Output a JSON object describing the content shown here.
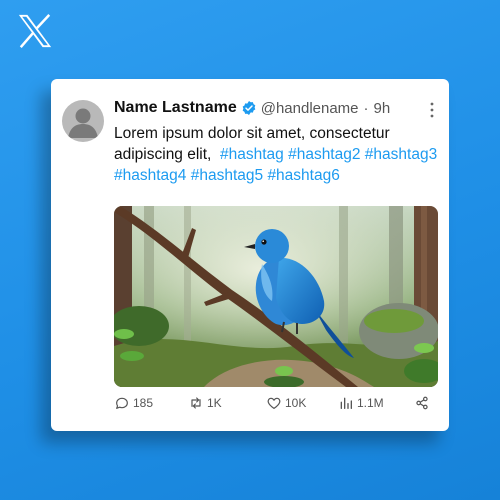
{
  "brand": {
    "logo_icon": "x-logo-icon"
  },
  "tweet": {
    "author_name": "Name Lastname",
    "handle": "@handlename",
    "separator": "·",
    "time": "9h",
    "verified_icon": "verified-badge-icon",
    "text": "Lorem ipsum dolor sit amet, consectetur adipiscing elit,",
    "hashtags": [
      "#hashtag",
      "#hashtag2",
      "#hashtag3",
      "#hashtag4",
      "#hashtag5",
      "#hashtag6"
    ],
    "image_subject": "blue bird perched on a branch in a forest",
    "metrics": {
      "replies": "185",
      "retweets": "1K",
      "likes": "10K",
      "views": "1.1M"
    }
  },
  "colors": {
    "background": "#1f8fe6",
    "accent": "#1d9bf0",
    "card": "#ffffff",
    "text": "#111111",
    "muted": "#555555"
  }
}
